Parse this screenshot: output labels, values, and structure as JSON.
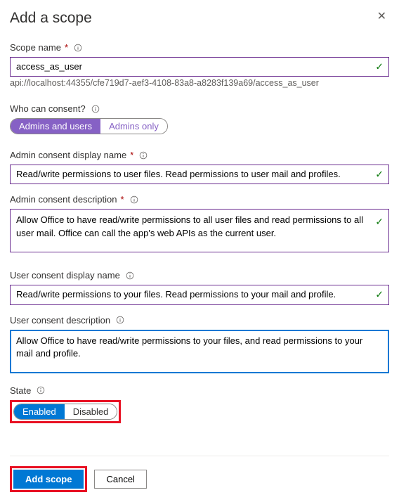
{
  "header": {
    "title": "Add a scope"
  },
  "scope_name": {
    "label": "Scope name",
    "value": "access_as_user",
    "uri": "api://localhost:44355/cfe719d7-aef3-4108-83a8-a8283f139a69/access_as_user"
  },
  "consent_who": {
    "label": "Who can consent?",
    "opt1": "Admins and users",
    "opt2": "Admins only"
  },
  "admin_display": {
    "label": "Admin consent display name",
    "value": "Read/write permissions to user files. Read permissions to user mail and profiles."
  },
  "admin_desc": {
    "label": "Admin consent description",
    "value": "Allow Office to have read/write permissions to all user files and read permissions to all user mail. Office can call the app's web APIs as the current user."
  },
  "user_display": {
    "label": "User consent display name",
    "value": "Read/write permissions to your files. Read permissions to your mail and profile."
  },
  "user_desc": {
    "label": "User consent description",
    "value": "Allow Office to have read/write permissions to your files, and read permissions to your mail and profile."
  },
  "state": {
    "label": "State",
    "opt1": "Enabled",
    "opt2": "Disabled"
  },
  "footer": {
    "primary": "Add scope",
    "secondary": "Cancel"
  }
}
